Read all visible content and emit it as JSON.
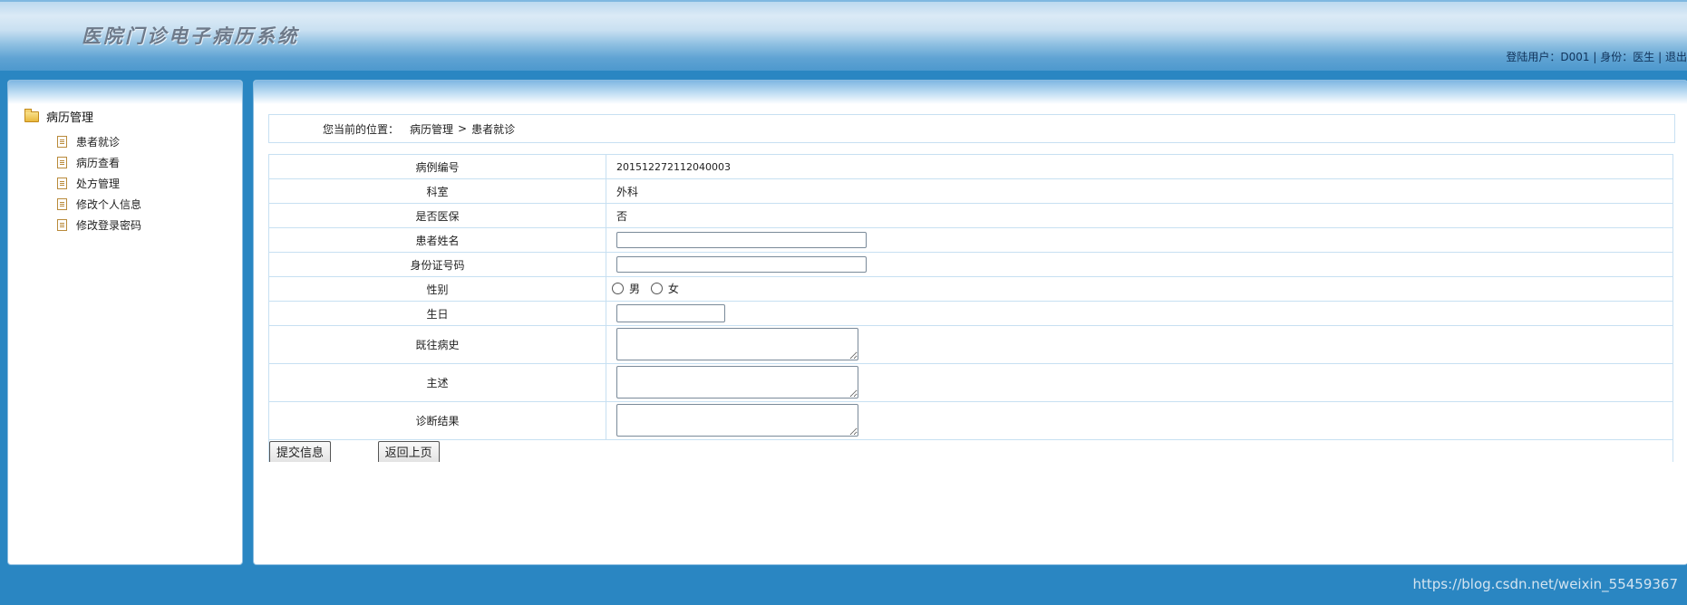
{
  "header": {
    "title": "医院门诊电子病历系统",
    "login_label": "登陆用户：",
    "user_id": "D001",
    "role_label": "身份：",
    "role": "医生",
    "logout": "退出"
  },
  "sidebar": {
    "group_label": "病历管理",
    "items": [
      {
        "label": "患者就诊"
      },
      {
        "label": "病历查看"
      },
      {
        "label": "处方管理"
      },
      {
        "label": "修改个人信息"
      },
      {
        "label": "修改登录密码"
      }
    ]
  },
  "breadcrumb": {
    "prefix": "您当前的位置：",
    "level1": "病历管理",
    "separator": ">",
    "level2": "患者就诊"
  },
  "form": {
    "case_no_label": "病例编号",
    "case_no": "201512272112040003",
    "dept_label": "科室",
    "dept": "外科",
    "insurance_label": "是否医保",
    "insurance": "否",
    "name_label": "患者姓名",
    "name_value": "",
    "id_label": "身份证号码",
    "id_value": "",
    "gender_label": "性别",
    "gender_male": "男",
    "gender_female": "女",
    "birthday_label": "生日",
    "birthday_value": "",
    "history_label": "既往病史",
    "complaint_label": "主述",
    "diagnosis_label": "诊断结果",
    "submit": "提交信息",
    "back": "返回上页"
  },
  "watermark": "https://blog.csdn.net/weixin_55459367"
}
